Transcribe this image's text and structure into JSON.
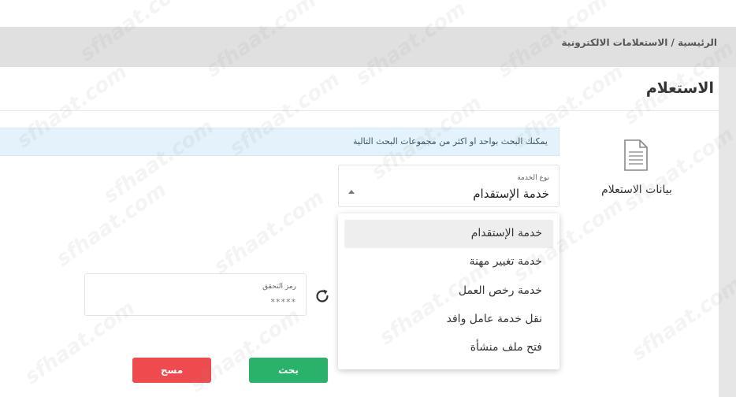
{
  "breadcrumb": "الرئيسية / الاستعلامات الالكترونية",
  "page_title": "الاستعلام",
  "side": {
    "label": "بيانات الاستعلام",
    "icon": "document-icon"
  },
  "info_text": "يمكنك البحث بواحد او اكثر من مجموعات البحث التالية",
  "service_select": {
    "label": "نوع الخدمة",
    "value": "خدمة الإستقدام",
    "options": [
      "خدمة الإستقدام",
      "خدمة تغيير مهنة",
      "خدمة رخص العمل",
      "نقل خدمة عامل وافد",
      "فتح ملف منشأة"
    ]
  },
  "captcha": {
    "label": "رمز التحقق",
    "placeholder": "*****"
  },
  "buttons": {
    "search": "بحث",
    "clear": "مسح"
  },
  "watermark": "sfhaat.com",
  "colors": {
    "search": "#2ab26b",
    "clear": "#ef4b4f",
    "info_bg": "#e3f2fb"
  }
}
